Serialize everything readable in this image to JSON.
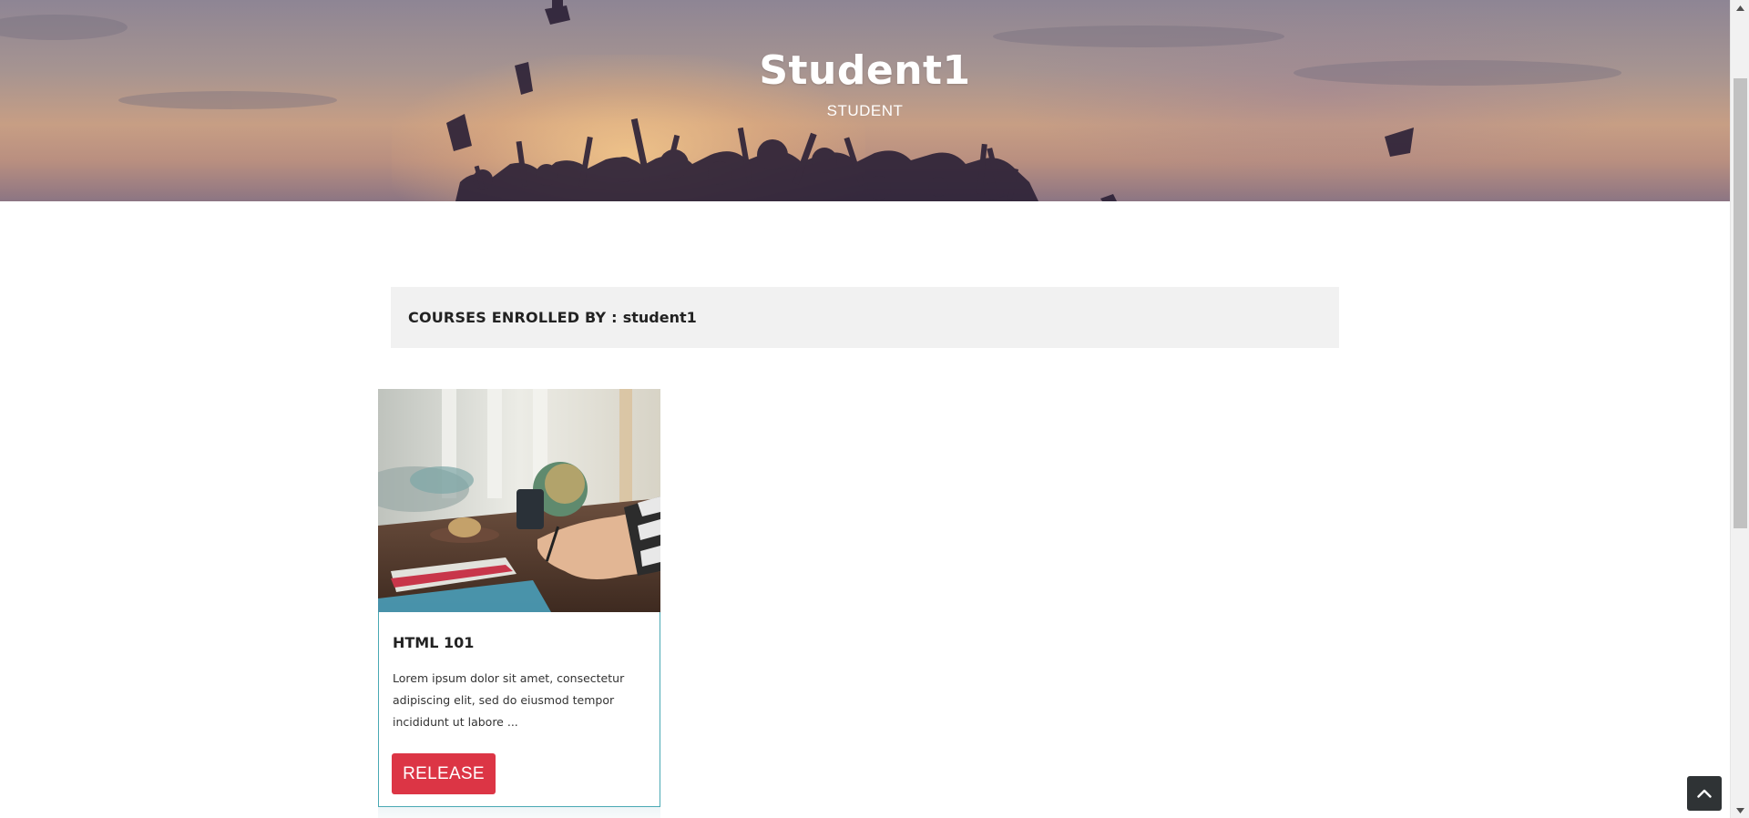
{
  "hero": {
    "title": "Student1",
    "subtitle": "STUDENT"
  },
  "enrolled_section": {
    "heading_prefix": "COURSES ENROLLED BY :",
    "username": "student1"
  },
  "courses": [
    {
      "title": "HTML 101",
      "description": "Lorem ipsum dolor sit amet, consectetur adipiscing elit, sed do eiusmod tempor incididunt ut labore ...",
      "button_label": "RELEASE"
    }
  ],
  "icons": {
    "back_to_top": "chevron-up-icon",
    "scroll_up": "scroll-up-arrow-icon",
    "scroll_down": "scroll-down-arrow-icon"
  },
  "colors": {
    "release_button": "#dc3545",
    "card_border": "#4aa9b4",
    "heading_bar": "#f1f1f1",
    "back_to_top": "#2f3335"
  }
}
